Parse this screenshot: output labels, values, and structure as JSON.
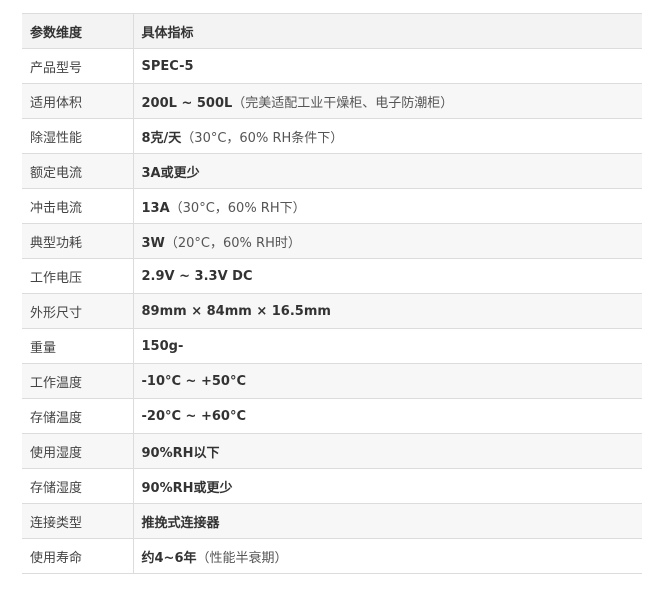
{
  "table": {
    "header": {
      "key": "参数维度",
      "value": "具体指标"
    },
    "rows": [
      {
        "key": "产品型号",
        "value": "SPEC-5",
        "note": ""
      },
      {
        "key": "适用体积",
        "value": "200L ~ 500L",
        "note": "（完美适配工业干燥柜、电子防潮柜）"
      },
      {
        "key": "除湿性能",
        "value": "8克/天",
        "note": "（30°C，60% RH条件下）"
      },
      {
        "key": "额定电流",
        "value": "3A或更少",
        "note": ""
      },
      {
        "key": "冲击电流",
        "value": "13A",
        "note": "（30°C，60% RH下）"
      },
      {
        "key": "典型功耗",
        "value": "3W",
        "note": "（20°C，60% RH时）"
      },
      {
        "key": "工作电压",
        "value": "2.9V ~ 3.3V DC",
        "note": ""
      },
      {
        "key": "外形尺寸",
        "value": "89mm × 84mm × 16.5mm",
        "note": ""
      },
      {
        "key": "重量",
        "value": "150g-",
        "note": ""
      },
      {
        "key": "工作温度",
        "value": "-10°C ~ +50°C",
        "note": ""
      },
      {
        "key": "存储温度",
        "value": "-20°C ~ +60°C",
        "note": ""
      },
      {
        "key": "使用湿度",
        "value": "90%RH以下",
        "note": ""
      },
      {
        "key": "存储湿度",
        "value": "90%RH或更少",
        "note": ""
      },
      {
        "key": "连接类型",
        "value": "推挽式连接器",
        "note": ""
      },
      {
        "key": "使用寿命",
        "value": "约4~6年",
        "note": "（性能半衰期）"
      }
    ]
  }
}
